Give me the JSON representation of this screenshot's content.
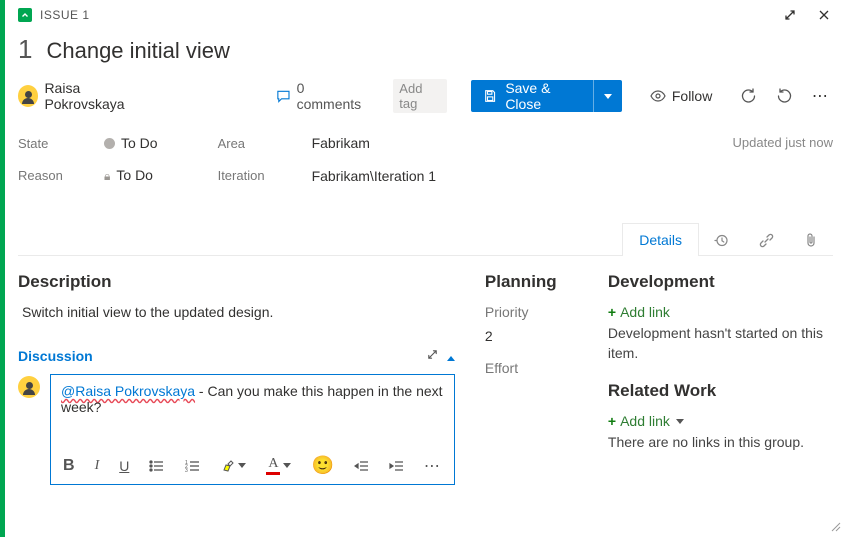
{
  "header": {
    "issueLabel": "ISSUE 1",
    "number": "1",
    "title": "Change initial view"
  },
  "assignee": {
    "name": "Raisa Pokrovskaya"
  },
  "comments": {
    "count": "0 comments"
  },
  "addTag": "Add tag",
  "save": {
    "label": "Save & Close"
  },
  "follow": "Follow",
  "updated": "Updated just now",
  "fields": {
    "stateLabel": "State",
    "state": "To Do",
    "reasonLabel": "Reason",
    "reason": "To Do",
    "areaLabel": "Area",
    "area": "Fabrikam",
    "iterationLabel": "Iteration",
    "iteration": "Fabrikam\\Iteration 1"
  },
  "tabs": {
    "details": "Details"
  },
  "description": {
    "heading": "Description",
    "text": "Switch initial view to the updated design."
  },
  "discussion": {
    "heading": "Discussion",
    "mention": "@Raisa Pokrovskaya",
    "text": " - Can you make this happen in the next week?"
  },
  "planning": {
    "heading": "Planning",
    "priorityLabel": "Priority",
    "priority": "2",
    "effortLabel": "Effort"
  },
  "development": {
    "heading": "Development",
    "addLink": "Add link",
    "hint": "Development hasn't started on this item."
  },
  "related": {
    "heading": "Related Work",
    "addLink": "Add link",
    "hint": "There are no links in this group."
  }
}
